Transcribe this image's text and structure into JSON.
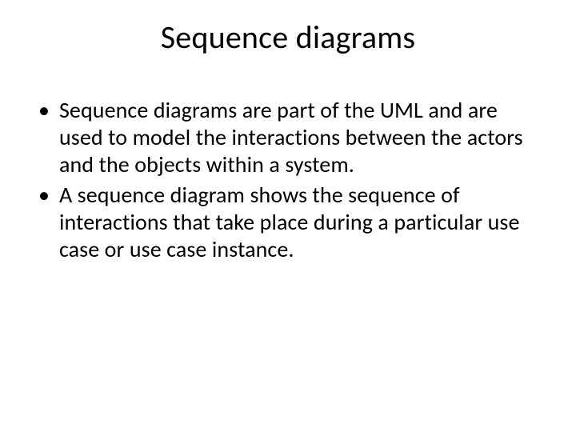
{
  "slide": {
    "title": "Sequence diagrams",
    "bullets": [
      "Sequence diagrams are part of the UML and are used to model the interactions between the actors and the objects within a system.",
      "A sequence diagram shows the sequence of interactions that take place during a particular use case or use case instance."
    ]
  }
}
